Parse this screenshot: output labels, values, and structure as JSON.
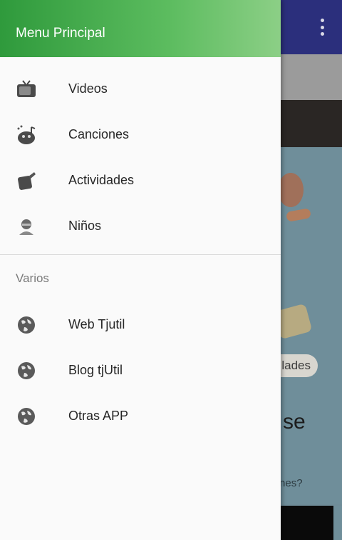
{
  "background": {
    "chip_text": "lades",
    "heading_text": "e se",
    "question_text": "niones?"
  },
  "drawer": {
    "title": "Menu Principal",
    "items": [
      {
        "label": "Videos",
        "icon": "tv-icon"
      },
      {
        "label": "Canciones",
        "icon": "music-icon"
      },
      {
        "label": "Actividades",
        "icon": "activity-icon"
      },
      {
        "label": "Niños",
        "icon": "child-icon"
      }
    ],
    "section_title": "Varios",
    "links": [
      {
        "label": "Web Tjutil",
        "icon": "globe-icon"
      },
      {
        "label": "Blog tjUtil",
        "icon": "globe-icon"
      },
      {
        "label": "Otras APP",
        "icon": "globe-icon"
      }
    ]
  },
  "colors": {
    "header_start": "#2f9a3c",
    "header_end": "#8ccf86",
    "toolbar": "#2b2f7c"
  }
}
